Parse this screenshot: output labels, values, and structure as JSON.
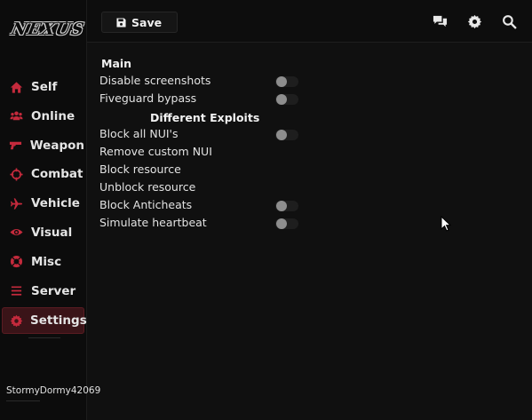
{
  "app": {
    "logo_text": "NEXUS"
  },
  "colors": {
    "accent": "#b8263a",
    "active_bg": "#3a1418",
    "background": "#101010"
  },
  "sidebar": {
    "items": [
      {
        "label": "Self",
        "icon": "home-icon"
      },
      {
        "label": "Online",
        "icon": "users-icon"
      },
      {
        "label": "Weapon",
        "icon": "gun-icon"
      },
      {
        "label": "Combat",
        "icon": "crosshair-icon"
      },
      {
        "label": "Vehicle",
        "icon": "plane-icon"
      },
      {
        "label": "Visual",
        "icon": "eye-icon"
      },
      {
        "label": "Misc",
        "icon": "lifebuoy-icon"
      },
      {
        "label": "Server",
        "icon": "menu-icon"
      },
      {
        "label": "Settings",
        "icon": "gear-icon",
        "active": true
      }
    ],
    "username": "StormyDormy42069"
  },
  "toolbar": {
    "save_label": "Save",
    "icons": [
      "chat-icon",
      "gear-icon",
      "search-icon"
    ]
  },
  "main": {
    "section_main": "Main",
    "section_exploits": "Different Exploits",
    "rows": [
      {
        "label": "Disable screenshots",
        "toggle": true,
        "on": false
      },
      {
        "label": "Fiveguard bypass",
        "toggle": true,
        "on": false
      },
      {
        "label": "Block all NUI's",
        "toggle": true,
        "on": false
      },
      {
        "label": "Remove custom NUI",
        "toggle": false
      },
      {
        "label": "Block resource",
        "toggle": false
      },
      {
        "label": "Unblock resource",
        "toggle": false
      },
      {
        "label": "Block Anticheats",
        "toggle": true,
        "on": false
      },
      {
        "label": "Simulate heartbeat",
        "toggle": true,
        "on": false
      }
    ]
  }
}
